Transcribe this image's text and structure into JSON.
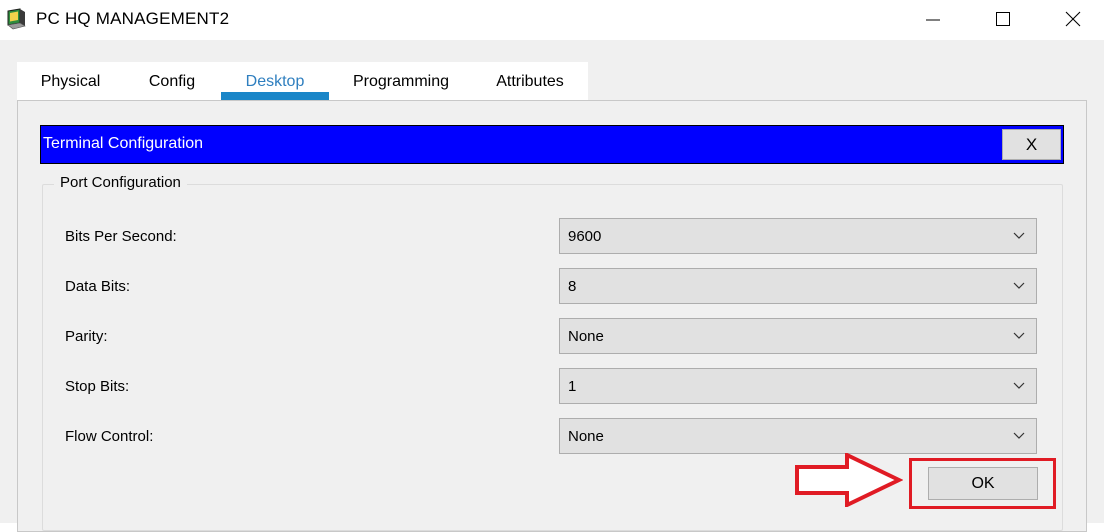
{
  "window": {
    "title": "PC HQ MANAGEMENT2"
  },
  "tabs": [
    {
      "label": "Physical"
    },
    {
      "label": "Config"
    },
    {
      "label": "Desktop"
    },
    {
      "label": "Programming"
    },
    {
      "label": "Attributes"
    }
  ],
  "active_tab": "Desktop",
  "dialog": {
    "title": "Terminal Configuration",
    "close_label": "X",
    "group_label": "Port Configuration",
    "fields": [
      {
        "label": "Bits Per Second:",
        "value": "9600"
      },
      {
        "label": "Data Bits:",
        "value": "8"
      },
      {
        "label": "Parity:",
        "value": "None"
      },
      {
        "label": "Stop Bits:",
        "value": "1"
      },
      {
        "label": "Flow Control:",
        "value": "None"
      }
    ],
    "ok_label": "OK"
  },
  "colors": {
    "header_blue": "#0000ff",
    "tab_active": "#2f7fbf",
    "annotation_red": "#e01b24"
  }
}
